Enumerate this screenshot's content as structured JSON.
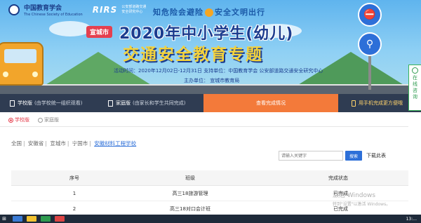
{
  "header": {
    "org1_name": "中国教育学会",
    "org1_sub": "The Chinese Society of Education",
    "org2_name": "RIRS",
    "org2_sub_line1": "公安部道路交通",
    "org2_sub_line2": "安全研究中心",
    "slogan_left": "知危险会避险",
    "slogan_right": "安全文明出行",
    "city_tag": "宣城市",
    "title_line1": "2020年中小学生(幼儿)",
    "title_line2": "交通安全教育专题",
    "info_line1": "活动时间：2020年12月02日-12月31日  支持单位：中国教育学会 公安部道路交通安全研究中心",
    "info_line2": "主办单位：  宣城市教育局"
  },
  "nav": {
    "school_label": "学校版",
    "school_hint": "(由学校统一组织观看)",
    "family_label": "家庭版",
    "family_hint": "(由家长和学生共同完成)",
    "progress_label": "查看完成情况",
    "mobile_label": "用手机完成更方便哦"
  },
  "tabs": {
    "school": "学校版",
    "family": "家庭版"
  },
  "breadcrumb": {
    "items": [
      "全国",
      "安徽省",
      "宣城市",
      "宁国市"
    ],
    "current": "安徽材料工程学校"
  },
  "search": {
    "placeholder": "请输入关键字",
    "button": "搜索",
    "download": "下载此表"
  },
  "table": {
    "headers": [
      "序号",
      "班级",
      "完成状态"
    ],
    "rows": [
      [
        "1",
        "高三18旅游管理",
        "已完成"
      ],
      [
        "2",
        "高三18对口会计班",
        "已完成"
      ]
    ]
  },
  "side_float": {
    "line1": "在",
    "line2": "线",
    "line3": "咨",
    "line4": "询"
  },
  "watermark": {
    "line1": "激活 Windows",
    "line2": "转到\"设置\"以激活 Windows。"
  },
  "taskbar": {
    "time": "13:..."
  },
  "colors": {
    "nav_bg": "#2f3c52",
    "accent_orange": "#f37a3a",
    "accent_red": "#e5404f",
    "link_blue": "#2d6fd8"
  }
}
